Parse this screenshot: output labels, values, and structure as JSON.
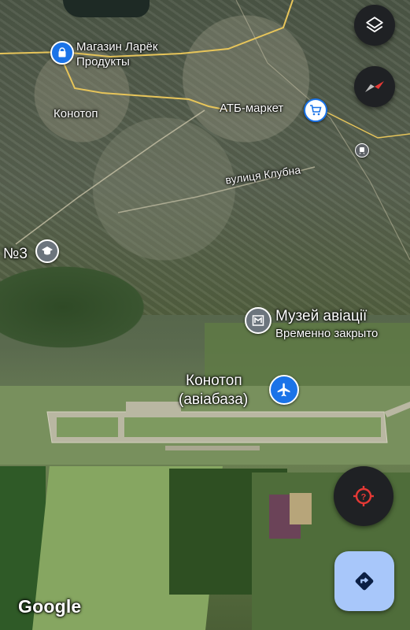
{
  "map": {
    "places": {
      "shop": "Магазин Ларёк",
      "shop_sub": "Продукты",
      "city": "Конотоп",
      "atb": "АТБ-маркет",
      "street": "вулиця Клубна",
      "school_fragment": "№3",
      "museum": "Музей авіації",
      "museum_status": "Временно закрыто",
      "airbase_line1": "Конотоп",
      "airbase_line2": "(авіабаза)"
    },
    "attribution": "Google"
  },
  "colors": {
    "shop_pin": "#1a73e8",
    "atb_pin": "#1a73e8",
    "museum_pin": "#6c757d",
    "school_pin": "#6c757d",
    "airport_pin": "#1a73e8",
    "fab_dark": "#1f2124",
    "compass_red": "#e53935",
    "locate_red": "#e53935",
    "directions_bg": "#a8c7fa"
  },
  "icons": [
    "layers-icon",
    "compass-icon",
    "shop-icon",
    "cart-icon",
    "train-icon",
    "school-icon",
    "museum-icon",
    "airport-icon",
    "my-location-icon",
    "directions-icon"
  ]
}
